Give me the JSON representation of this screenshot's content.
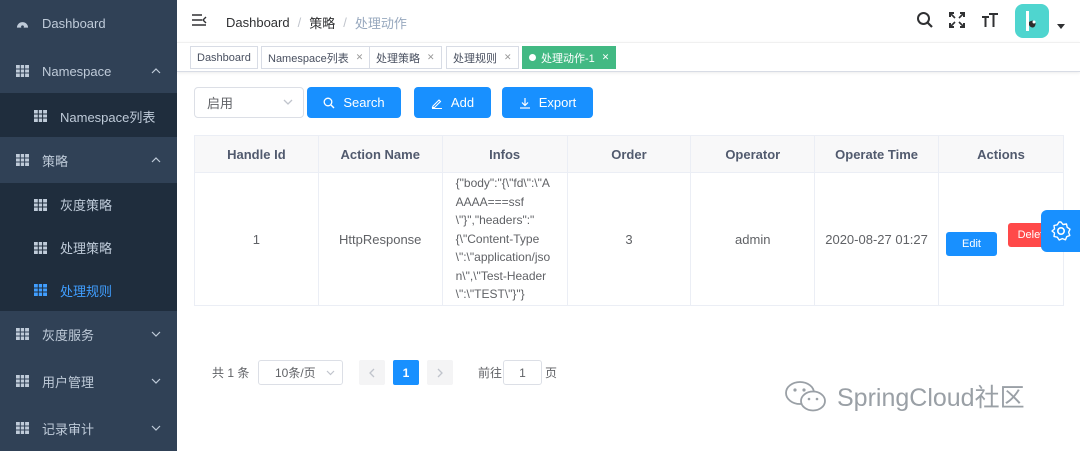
{
  "sidebar": {
    "items": [
      {
        "label": "Dashboard"
      },
      {
        "label": "Namespace"
      },
      {
        "label": "Namespace列表"
      },
      {
        "label": "策略"
      },
      {
        "label": "灰度策略"
      },
      {
        "label": "处理策略"
      },
      {
        "label": "处理规则"
      },
      {
        "label": "灰度服务"
      },
      {
        "label": "用户管理"
      },
      {
        "label": "记录审计"
      }
    ],
    "active_color": "#409eff"
  },
  "header": {
    "breadcrumb": [
      "Dashboard",
      "策略",
      "处理动作"
    ],
    "breadcrumb_sep": "/",
    "icons": [
      "search-icon",
      "fullscreen-icon",
      "font-size-icon"
    ]
  },
  "tags": [
    {
      "label": "Dashboard",
      "closable": false
    },
    {
      "label": "Namespace列表",
      "closable": true
    },
    {
      "label": "处理策略",
      "closable": true
    },
    {
      "label": "处理规则",
      "closable": true
    },
    {
      "label": "处理动作-1",
      "closable": true,
      "active": true
    }
  ],
  "filter": {
    "status_value": "启用"
  },
  "buttons": {
    "search": "Search",
    "add": "Add",
    "export": "Export"
  },
  "table": {
    "columns": [
      "Handle Id",
      "Action Name",
      "Infos",
      "Order",
      "Operator",
      "Operate Time",
      "Actions"
    ],
    "rows": [
      {
        "handle_id": "1",
        "action_name": "HttpResponse",
        "infos": "{\"body\":\"{\\\"fd\\\":\\\"AAAAA===ssf\\\"}\",\"headers\":\"{\\\"Content-Type\\\":\\\"application/json\\\",\\\"Test-Header\\\":\\\"TEST\\\"}\"}",
        "order": "3",
        "operator": "admin",
        "operate_time": "2020-08-27 01:27",
        "edit_label": "Edit",
        "delete_label": "Delete"
      }
    ]
  },
  "pagination": {
    "total": "共 1 条",
    "page_size": "10条/页",
    "current_page": "1",
    "jump_prefix": "前往",
    "jump_value": "1",
    "jump_suffix": "页"
  },
  "watermark": "SpringCloud社区",
  "colors": {
    "sidebar_bg": "#304156",
    "primary": "#1890ff",
    "tag_active": "#42b983",
    "danger": "#ff4949"
  }
}
